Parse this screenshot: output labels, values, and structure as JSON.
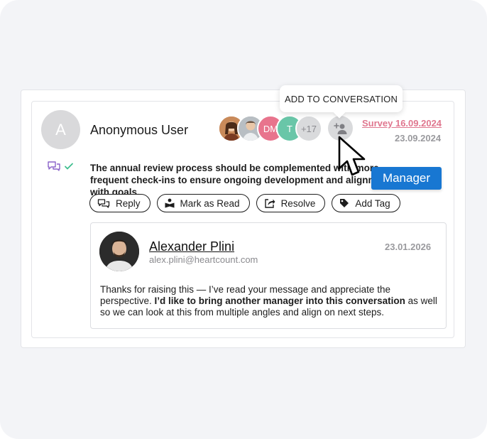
{
  "tooltip": {
    "text": "ADD TO CONVERSATION"
  },
  "comment": {
    "avatar_initial": "A",
    "author": "Anonymous User",
    "survey_link": "Survey 16.09.2024",
    "date": "23.09.2024",
    "message": "The annual review process should be complemented with more frequent check-ins to ensure ongoing development and alignment with goals.",
    "status_icons": [
      "comments-icon",
      "check-icon"
    ]
  },
  "participants": {
    "items": [
      {
        "initials": "",
        "color": "#b06a3b",
        "icon": "photo-avatar-woman"
      },
      {
        "initials": "",
        "color": "#9aa1a6",
        "icon": "photo-avatar-man"
      },
      {
        "initials": "DM",
        "color": "#e8748d"
      },
      {
        "initials": "T",
        "color": "#69c6a8"
      }
    ],
    "more_count": "+17",
    "more_color": "#d9dadc"
  },
  "actions": [
    {
      "label": "Reply",
      "icon": "reply-icon"
    },
    {
      "label": "Mark as Read",
      "icon": "read-icon"
    },
    {
      "label": "Resolve",
      "icon": "resolve-icon"
    },
    {
      "label": "Add Tag",
      "icon": "tag-icon"
    }
  ],
  "manager_tag": {
    "label": "Manager",
    "color": "#1877d2"
  },
  "reply": {
    "name": "Alexander Plini",
    "email": "alex.plini@heartcount.com",
    "date": "23.01.2026",
    "body_before": "Thanks for raising this — I’ve read your message and appreciate the perspective. ",
    "body_bold": "I’d like to bring another manager into this conversation",
    "body_after": " as well so we can look at this from multiple angles and align on next steps."
  },
  "colors": {
    "background": "#f3f4f7",
    "survey_link": "#e0778f",
    "accent_blue": "#1877d2"
  }
}
